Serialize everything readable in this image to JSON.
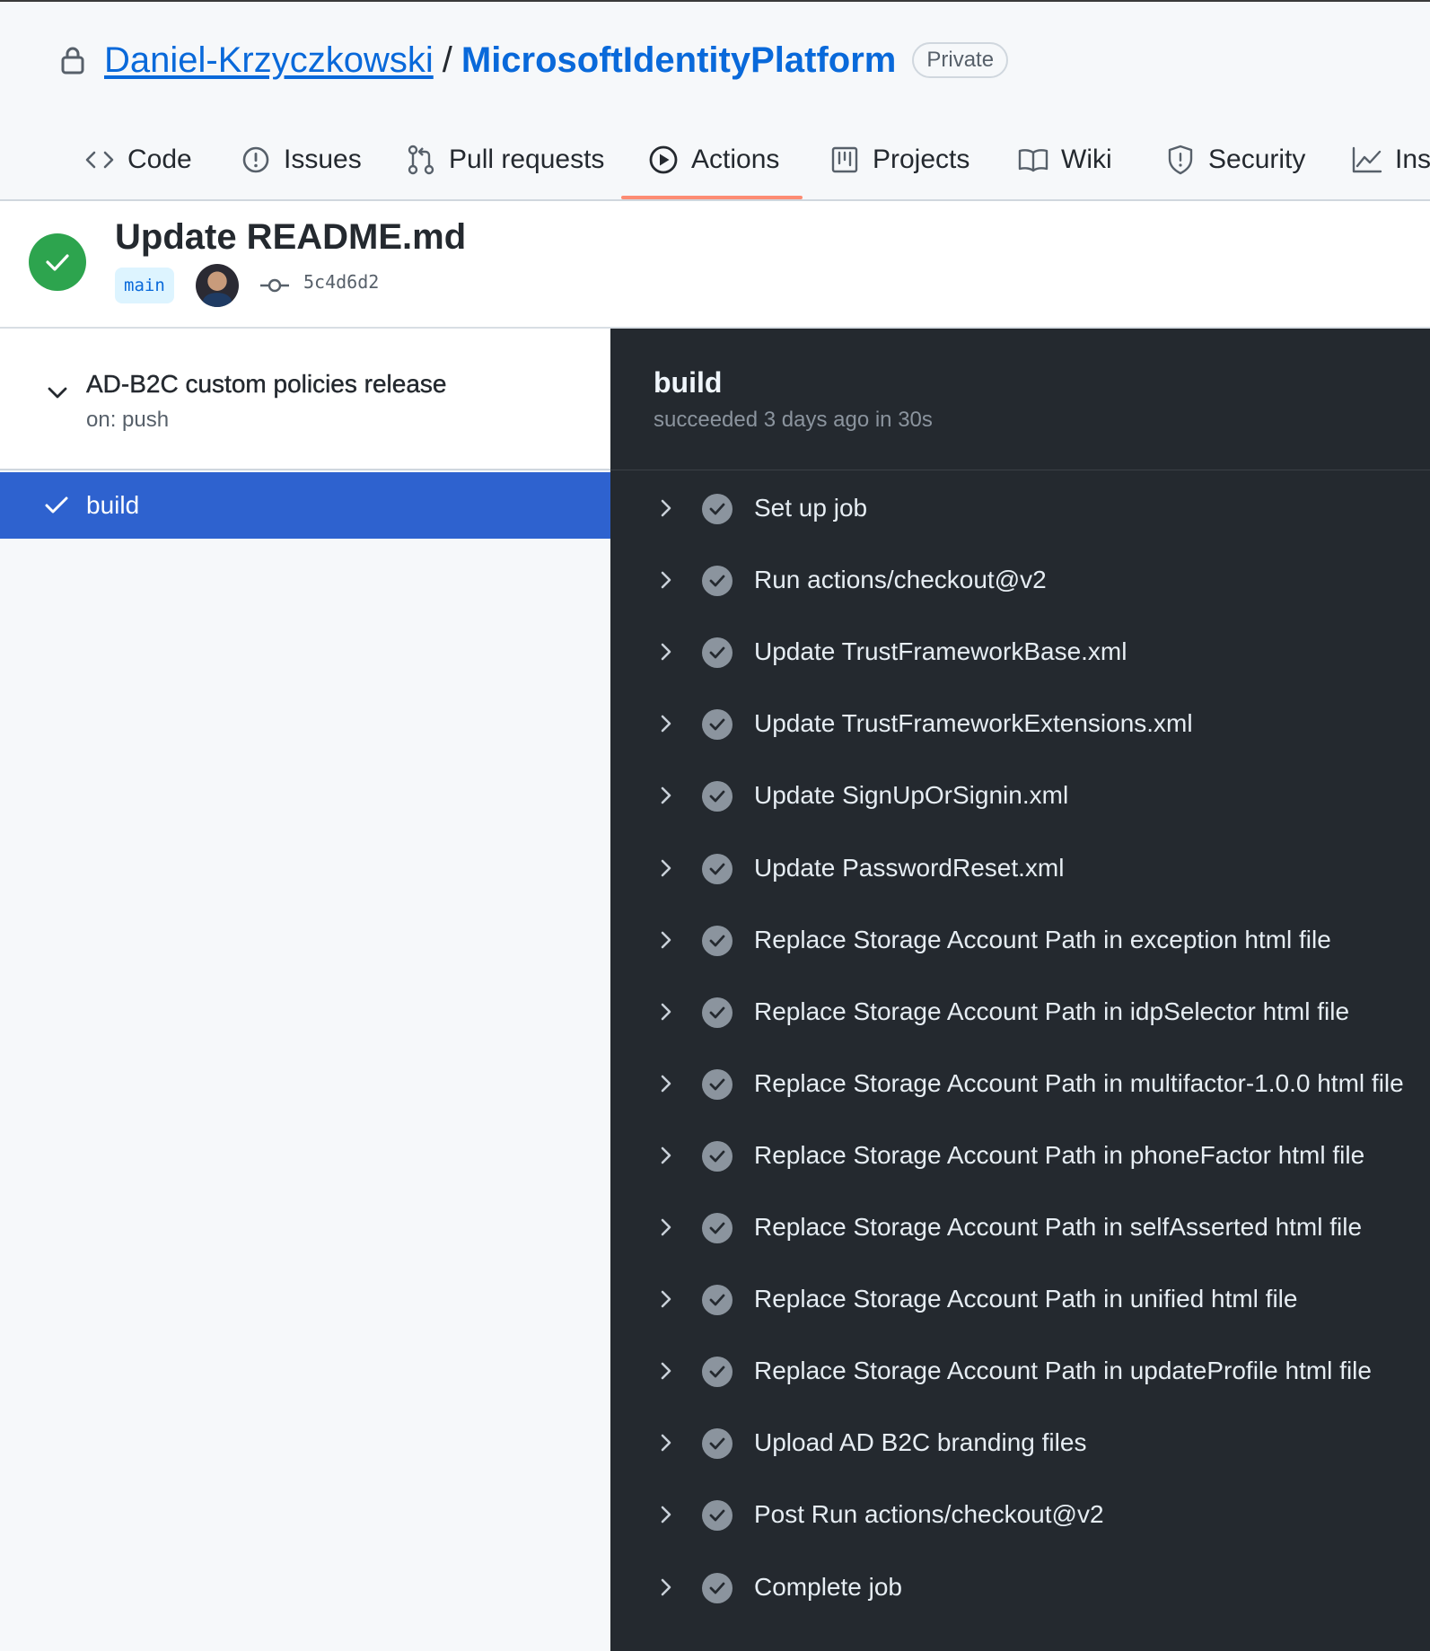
{
  "repo": {
    "owner": "Daniel-Krzyczkowski",
    "separator": "/",
    "name": "MicrosoftIdentityPlatform",
    "visibility": "Private"
  },
  "tabs": [
    {
      "label": "Code",
      "icon": "code-icon"
    },
    {
      "label": "Issues",
      "icon": "issue-icon"
    },
    {
      "label": "Pull requests",
      "icon": "pull-request-icon"
    },
    {
      "label": "Actions",
      "icon": "play-icon",
      "active": true
    },
    {
      "label": "Projects",
      "icon": "project-icon"
    },
    {
      "label": "Wiki",
      "icon": "book-icon"
    },
    {
      "label": "Security",
      "icon": "shield-icon"
    },
    {
      "label": "Insi",
      "icon": "graph-icon"
    }
  ],
  "run": {
    "title": "Update README.md",
    "status": "success",
    "branch": "main",
    "commit": "5c4d6d2"
  },
  "workflow": {
    "name": "AD-B2C custom policies release",
    "trigger": "on: push",
    "jobs": [
      {
        "name": "build",
        "status": "success",
        "selected": true
      }
    ]
  },
  "log": {
    "job_title": "build",
    "summary": "succeeded 3 days ago in 30s",
    "steps": [
      "Set up job",
      "Run actions/checkout@v2",
      "Update TrustFrameworkBase.xml",
      "Update TrustFrameworkExtensions.xml",
      "Update SignUpOrSignin.xml",
      "Update PasswordReset.xml",
      "Replace Storage Account Path in exception html file",
      "Replace Storage Account Path in idpSelector html file",
      "Replace Storage Account Path in multifactor-1.0.0 html file",
      "Replace Storage Account Path in phoneFactor html file",
      "Replace Storage Account Path in selfAsserted html file",
      "Replace Storage Account Path in unified html file",
      "Replace Storage Account Path in updateProfile html file",
      "Upload AD B2C branding files",
      "Post Run actions/checkout@v2",
      "Complete job"
    ]
  },
  "colors": {
    "link": "#0969da",
    "success": "#2da44e",
    "active_tab_underline": "#fd8c73",
    "selected_job": "#2e62cf",
    "log_background": "#24292f"
  }
}
